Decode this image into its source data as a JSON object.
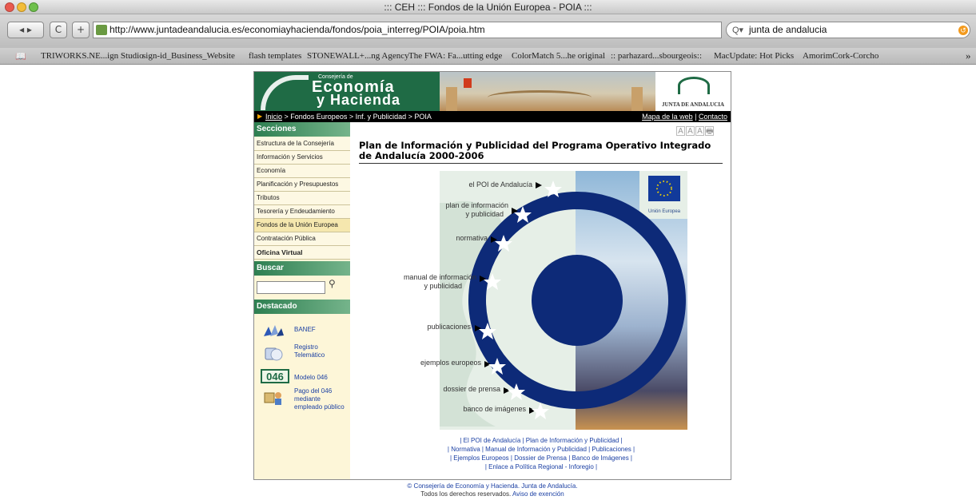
{
  "browser": {
    "window_title": "::: CEH ::: Fondos de la Unión Europea - POIA :::",
    "url": "http://www.juntadeandalucia.es/economiayhacienda/fondos/poia_interreg/POIA/poia.htm",
    "search_value": "junta de andalucia",
    "back_label": "◂ ▸",
    "reload_label": "C",
    "add_label": "+",
    "bookmarks": [
      "TRIWORKS.NE...ign Studio",
      "sign-id_Business_Website",
      "flash templates",
      "STONEWALL+...ng Agency",
      "The FWA: Fa...utting edge",
      "ColorMatch 5...he original",
      ":: parhazard...sbourgeois::",
      "MacUpdate: Hot Picks",
      "AmorimCork-Corcho"
    ],
    "bookmarks_overflow": "»"
  },
  "banner": {
    "brand_small": "Consejería de",
    "brand_line1": "Economía",
    "brand_line2": "y Hacienda",
    "junta_text": "JUNTA DE ANDALUCIA"
  },
  "navbar": {
    "breadcrumb": [
      "Inicio",
      "Fondos Europeos",
      "Inf. y Publicidad",
      "POIA"
    ],
    "links": [
      "Mapa de la web",
      "Contacto"
    ]
  },
  "sidebar": {
    "sections_title": "Secciones",
    "items": [
      "Estructura de la Consejería",
      "Información y Servicios",
      "Economía",
      "Planificación y Presupuestos",
      "Tributos",
      "Tesorería y Endeudamiento",
      "Fondos de la Unión Europea",
      "Contratación Pública",
      "Oficina Virtual"
    ],
    "search_title": "Buscar",
    "featured_title": "Destacado",
    "featured": [
      {
        "label": "BANEF",
        "icon": "banef-icon"
      },
      {
        "label": "Registro Telemático",
        "icon": "registro-icon"
      },
      {
        "label": "Modelo 046",
        "icon": "modelo-046-icon",
        "badge": "046"
      },
      {
        "label": "Pago del 046 mediante empleado público",
        "icon": "pago-icon"
      }
    ]
  },
  "main": {
    "text_size_controls": [
      "A",
      "A",
      "A",
      "🖶"
    ],
    "title": "Plan de Información y Publicidad del Programa Operativo Integrado de Andalucía 2000-2006",
    "diagram_links": [
      "el POI de Andalucía",
      "plan de información\ny publicidad",
      "normativa",
      "manual de información\ny publicidad",
      "publicaciones",
      "ejemplos europeos",
      "dossier de prensa",
      "banco de imágenes"
    ],
    "eu_label": "Unión Europea",
    "footer_lines": [
      "| El POI de Andalucía | Plan de Información y Publicidad |",
      "| Normativa | Manual de Información y Publicidad | Publicaciones |",
      "| Ejemplos Europeos | Dossier de Prensa | Banco de Imágenes |",
      "| Enlace a Política Regional - Inforegio |"
    ]
  },
  "footer": {
    "copyright": "© Consejería de Economía y Hacienda. Junta de Andalucía.",
    "rights": "Todos los derechos reservados.",
    "exemption": "Aviso de exención"
  },
  "colors": {
    "brand_green": "#1f6b45",
    "diagram_blue": "#0d2a78",
    "link_blue": "#1a3fa3",
    "sidebar_bg": "#fdf6d8"
  }
}
